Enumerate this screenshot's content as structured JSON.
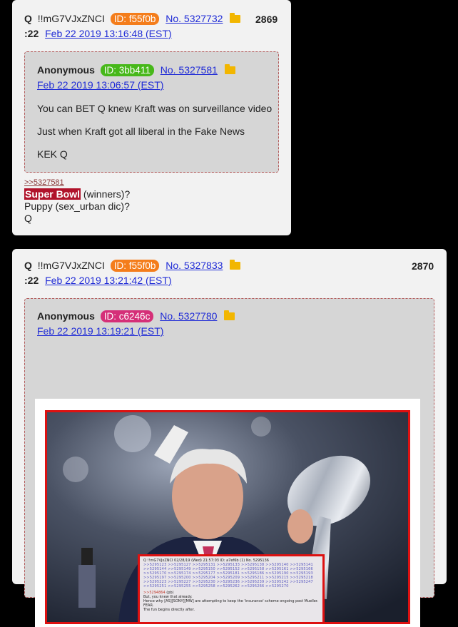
{
  "colors": {
    "id_orange": "#f47d1b",
    "id_green": "#47b81a",
    "id_pink": "#d52f78",
    "link": "#1f2bd6",
    "highlight": "#b0122a"
  },
  "posts": [
    {
      "author": "Q",
      "tripcode": "!!mG7VJxZNCI",
      "id": "ID: f55f0b",
      "no": "No. 5327732",
      "count": "2869",
      "time_prefix": ":22",
      "date": "Feb 22 2019 13:16:48 (EST)",
      "quote": {
        "author": "Anonymous",
        "id": "ID: 3bb411",
        "no": "No. 5327581",
        "date": "Feb 22 2019 13:06:57 (EST)",
        "lines": [
          "You can BET Q knew Kraft was on surveillance video",
          "Just when Kraft got all liberal in the Fake News",
          "KEK Q"
        ]
      },
      "reply": ">>5327581",
      "body": {
        "highlight": "Super Bowl",
        "line1_rest": " (winners)?",
        "line2": "Puppy (sex_urban dic)?",
        "line3": "Q"
      }
    },
    {
      "author": "Q",
      "tripcode": "!!mG7VJxZNCI",
      "id": "ID: f55f0b",
      "no": "No. 5327833",
      "count": "2870",
      "time_prefix": ":22",
      "date": "Feb 22 2019 13:21:42 (EST)",
      "quote": {
        "author": "Anonymous",
        "id": "ID: c6246c",
        "no": "No. 5327780",
        "date": "Feb 22 2019 13:19:21 (EST)"
      },
      "image_inset": {
        "header": "Q !!mG7VJxZNCI  02/28/19 (Wed) 21:57:03  ID: a7ef6b (1)  No. 5295136",
        "reply": ">>5294864",
        "reply_suffix": "(pb)",
        "lines": [
          "But, you knew that already.",
          "Hence why [AS][SONY][MW] are attempting to keep the 'insurance' scheme ongoing post Mueller.",
          "FEAR.",
          "The fun begins directly after."
        ]
      }
    }
  ]
}
